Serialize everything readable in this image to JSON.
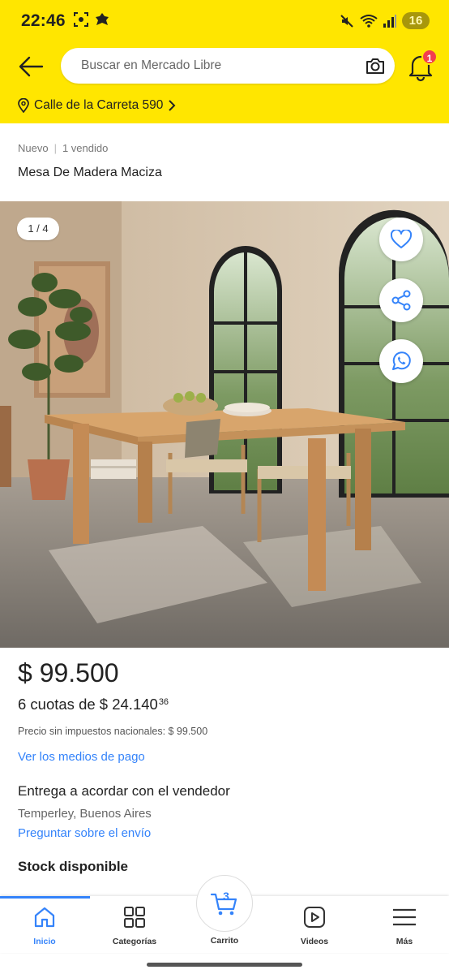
{
  "status_bar": {
    "time": "22:46",
    "battery": "16"
  },
  "header": {
    "search_placeholder": "Buscar en Mercado Libre",
    "notification_count": "1",
    "address": "Calle de la Carreta 590"
  },
  "product": {
    "condition": "Nuevo",
    "sold": "1 vendido",
    "title": "Mesa De Madera Maciza",
    "image_counter": "1 / 4",
    "price": "$ 99.500",
    "installments_prefix": "6 cuotas de $ 24.140",
    "installments_cents": "36",
    "tax_note": "Precio sin impuestos nacionales: $ 99.500",
    "payment_link": "Ver los medios de pago",
    "delivery": "Entrega a acordar con el vendedor",
    "location": "Temperley, Buenos Aires",
    "shipping_link": "Preguntar sobre el envío",
    "stock": "Stock disponible"
  },
  "bottom_nav": {
    "items": [
      {
        "label": "Inicio",
        "icon": "home-icon",
        "active": true
      },
      {
        "label": "Categorías",
        "icon": "grid-icon",
        "active": false
      },
      {
        "label": "Carrito",
        "icon": "cart-icon",
        "active": false,
        "badge": "3"
      },
      {
        "label": "Videos",
        "icon": "video-icon",
        "active": false
      },
      {
        "label": "Más",
        "icon": "menu-icon",
        "active": false
      }
    ]
  },
  "colors": {
    "brand_yellow": "#ffe600",
    "link_blue": "#3483fa",
    "badge_red": "#f23d4f"
  }
}
